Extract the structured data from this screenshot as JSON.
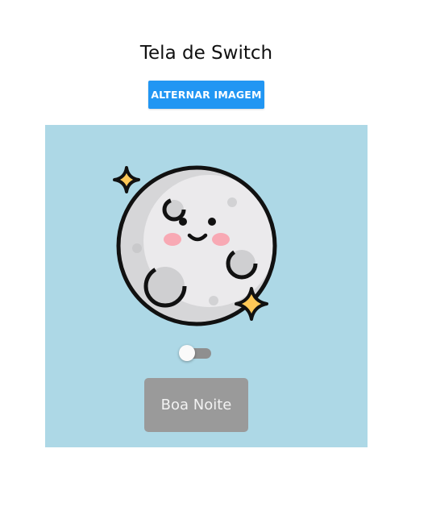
{
  "header": {
    "title": "Tela de Switch",
    "toggle_button_label": "ALTERNAR IMAGEM"
  },
  "panel": {
    "image_icon": "smiling-moon-icon",
    "switch": {
      "checked": false
    },
    "night_button_label": "Boa Noite"
  },
  "colors": {
    "accent": "#2196f3",
    "panel_background": "#add8e6",
    "night_button": "#9a9a9a",
    "switch_track": "#8f8f8f",
    "star": "#ffc857"
  }
}
